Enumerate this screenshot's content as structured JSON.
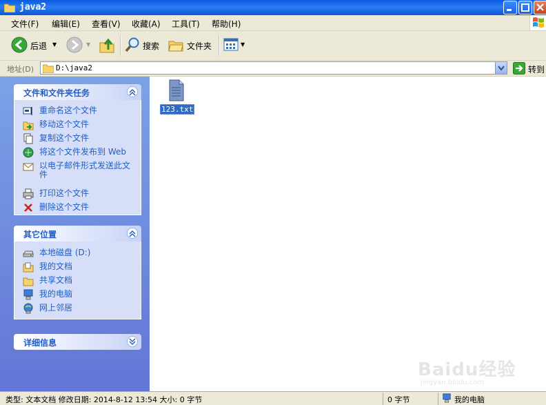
{
  "window": {
    "title": "java2"
  },
  "menu": [
    "文件(F)",
    "编辑(E)",
    "查看(V)",
    "收藏(A)",
    "工具(T)",
    "帮助(H)"
  ],
  "toolbar": {
    "back_label": "后退",
    "search_label": "搜索",
    "folders_label": "文件夹"
  },
  "address": {
    "label": "地址(D)",
    "value": "D:\\java2",
    "go_label": "转到"
  },
  "panels": {
    "tasks": {
      "title": "文件和文件夹任务",
      "items": [
        {
          "label": "重命名这个文件",
          "icon": "rename-icon"
        },
        {
          "label": "移动这个文件",
          "icon": "move-icon"
        },
        {
          "label": "复制这个文件",
          "icon": "copy-icon"
        },
        {
          "label": "将这个文件发布到 Web",
          "icon": "publish-web-icon"
        },
        {
          "label": "以电子邮件形式发送此文件",
          "icon": "email-icon"
        },
        {
          "label": "打印这个文件",
          "icon": "print-icon"
        },
        {
          "label": "删除这个文件",
          "icon": "delete-icon"
        }
      ]
    },
    "places": {
      "title": "其它位置",
      "items": [
        {
          "label": "本地磁盘 (D:)",
          "icon": "drive-icon"
        },
        {
          "label": "我的文档",
          "icon": "my-documents-icon"
        },
        {
          "label": "共享文档",
          "icon": "shared-documents-icon"
        },
        {
          "label": "我的电脑",
          "icon": "my-computer-icon"
        },
        {
          "label": "网上邻居",
          "icon": "network-icon"
        }
      ]
    },
    "details": {
      "title": "详细信息"
    }
  },
  "files": [
    {
      "name": "123.txt",
      "icon": "text-file-icon"
    }
  ],
  "status": {
    "info": "类型: 文本文档 修改日期: 2014-8-12 13:54 大小: 0 字节",
    "size": "0 字节",
    "location": "我的电脑"
  },
  "watermark": {
    "text": "Baidu经验",
    "url": "jingyan.baidu.com"
  },
  "colors": {
    "title_bar": "#0a5be0",
    "panel_title": "#215dc6",
    "selection": "#316ac5"
  }
}
